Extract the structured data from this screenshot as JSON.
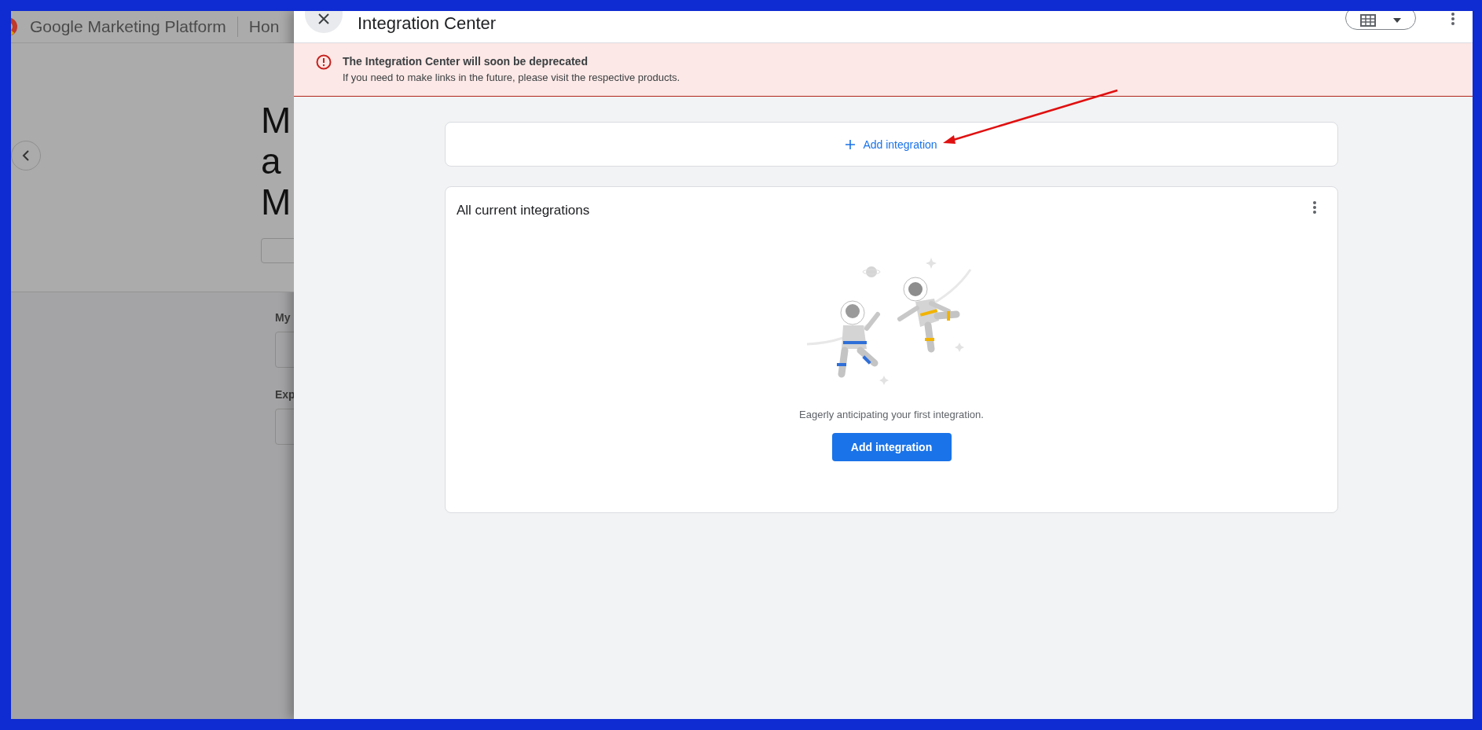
{
  "background_page": {
    "header": {
      "product": "Google Marketing Platform",
      "nav_item": "Hon"
    },
    "heading_lines": [
      "M",
      "a",
      "M"
    ],
    "section_labels": [
      "My",
      "Exp"
    ]
  },
  "panel": {
    "title": "Integration Center",
    "banner": {
      "title": "The Integration Center will soon be deprecated",
      "message": "If you need to make links in the future, please visit the respective products."
    },
    "add_card": {
      "label": "Add integration"
    },
    "integrations_card": {
      "title": "All current integrations",
      "empty_message": "Eagerly anticipating your first integration.",
      "button": "Add integration"
    }
  }
}
